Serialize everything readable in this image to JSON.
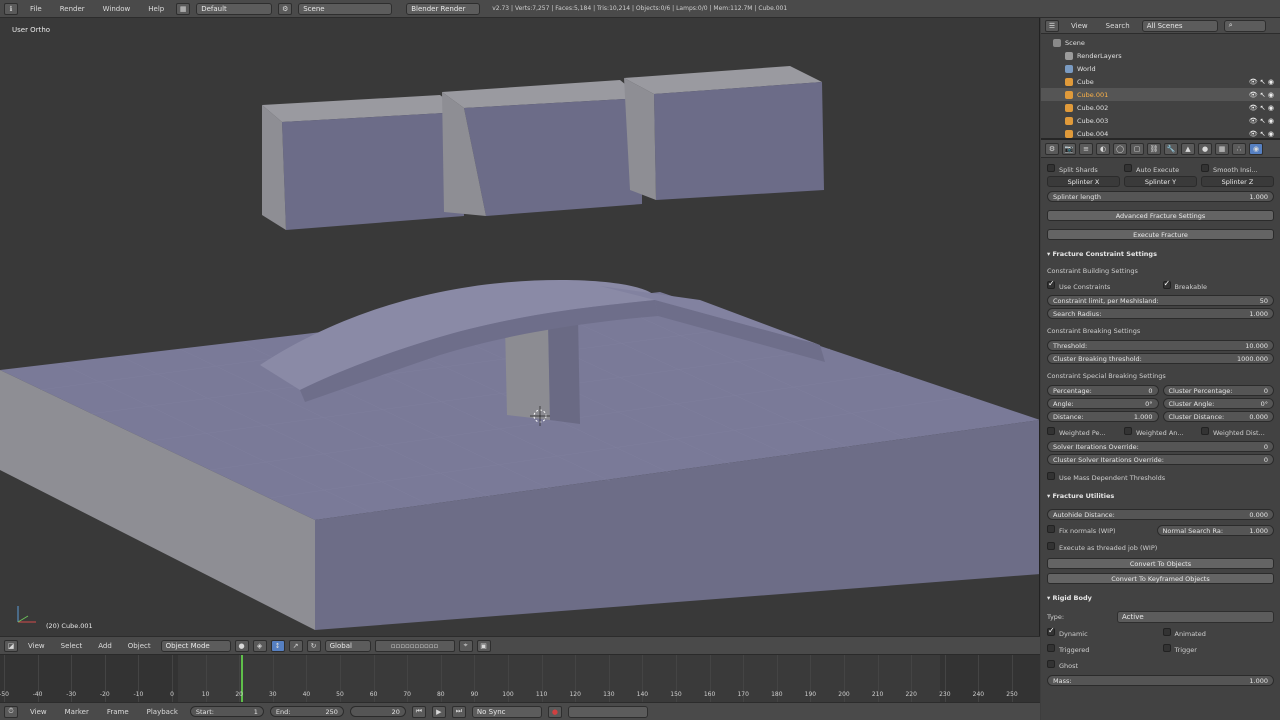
{
  "topbar": {
    "menus": [
      "File",
      "Render",
      "Window",
      "Help"
    ],
    "layout": "Default",
    "scene": "Scene",
    "engine": "Blender Render",
    "stats": "v2.73 | Verts:7,257 | Faces:5,184 | Tris:10,214 | Objects:0/6 | Lamps:0/0 | Mem:112.7M | Cube.001"
  },
  "viewport": {
    "view_label": "User Ortho",
    "object_label": "(20) Cube.001"
  },
  "vp_header": {
    "menus": [
      "View",
      "Select",
      "Add",
      "Object"
    ],
    "mode": "Object Mode",
    "orientation": "Global"
  },
  "timeline": {
    "ticks": [
      "-50",
      "-40",
      "-30",
      "-20",
      "-10",
      "0",
      "10",
      "20",
      "30",
      "40",
      "50",
      "60",
      "70",
      "80",
      "90",
      "100",
      "110",
      "120",
      "130",
      "140",
      "150",
      "160",
      "170",
      "180",
      "190",
      "200",
      "210",
      "220",
      "230",
      "240",
      "250"
    ],
    "current_frame": 20
  },
  "tl_header": {
    "menus": [
      "View",
      "Marker",
      "Frame",
      "Playback"
    ],
    "start_label": "Start:",
    "start_value": "1",
    "end_label": "End:",
    "end_value": "250",
    "frame_value": "20",
    "sync": "No Sync"
  },
  "outliner": {
    "header_menus": [
      "View",
      "Search"
    ],
    "filter": "All Scenes",
    "items": [
      {
        "label": "Scene",
        "indent": 0,
        "color": "#8a8a8a"
      },
      {
        "label": "RenderLayers",
        "indent": 1,
        "color": "#9b9b9b"
      },
      {
        "label": "World",
        "indent": 1,
        "color": "#7a9bc2"
      },
      {
        "label": "Cube",
        "indent": 1,
        "color": "#e09a3a"
      },
      {
        "label": "Cube.001",
        "indent": 1,
        "color": "#e09a3a",
        "selected": true
      },
      {
        "label": "Cube.002",
        "indent": 1,
        "color": "#e09a3a"
      },
      {
        "label": "Cube.003",
        "indent": 1,
        "color": "#e09a3a"
      },
      {
        "label": "Cube.004",
        "indent": 1,
        "color": "#e09a3a"
      }
    ]
  },
  "props": {
    "split_shards": "Split Shards",
    "auto_execute": "Auto Execute",
    "smooth_inner": "Smooth Insi...",
    "splinter_x": "Splinter X",
    "splinter_y": "Splinter Y",
    "splinter_z": "Splinter Z",
    "splinter_length_label": "Splinter length",
    "splinter_length_value": "1.000",
    "advanced": "Advanced Fracture Settings",
    "execute": "Execute Fracture",
    "constraint_section": "Fracture Constraint Settings",
    "constraint_building": "Constraint Building Settings",
    "use_constraints": "Use Constraints",
    "breakable": "Breakable",
    "limit_label": "Constraint limit, per MeshIsland:",
    "limit_value": "50",
    "search_radius_label": "Search Radius:",
    "search_radius_value": "1.000",
    "constraint_breaking": "Constraint Breaking Settings",
    "threshold_label": "Threshold:",
    "threshold_value": "10.000",
    "cluster_breaking_label": "Cluster Breaking threshold:",
    "cluster_breaking_value": "1000.000",
    "special_breaking": "Constraint Special Breaking Settings",
    "percentage_label": "Percentage:",
    "percentage_value": "0",
    "cluster_percentage_label": "Cluster Percentage:",
    "cluster_percentage_value": "0",
    "angle_label": "Angle:",
    "angle_value": "0°",
    "cluster_angle_label": "Cluster Angle:",
    "cluster_angle_value": "0°",
    "distance_label": "Distance:",
    "distance_value": "1.000",
    "cluster_distance_label": "Cluster Distance:",
    "cluster_distance_value": "0.000",
    "weighted_pe": "Weighted Pe...",
    "weighted_an": "Weighted An...",
    "weighted_dist": "Weighted Dist...",
    "solver_override_label": "Solver Iterations Override:",
    "solver_override_value": "0",
    "cluster_solver_label": "Cluster Solver Iterations Override:",
    "cluster_solver_value": "0",
    "mass_dependent": "Use Mass Dependent Thresholds",
    "utilities_section": "Fracture Utilities",
    "autohide_label": "Autohide Distance:",
    "autohide_value": "0.000",
    "fix_normals": "Fix normals (WIP)",
    "normal_search_label": "Normal Search Ra:",
    "normal_search_value": "1.000",
    "threaded": "Execute as threaded job (WIP)",
    "convert_objects": "Convert To Objects",
    "convert_keyframed": "Convert To Keyframed Objects",
    "rigid_section": "Rigid Body",
    "type_label": "Type:",
    "type_value": "Active",
    "dynamic": "Dynamic",
    "animated": "Animated",
    "triggered": "Triggered",
    "trigger": "Trigger",
    "ghost": "Ghost",
    "mass_label": "Mass:",
    "mass_value": "1.000"
  }
}
